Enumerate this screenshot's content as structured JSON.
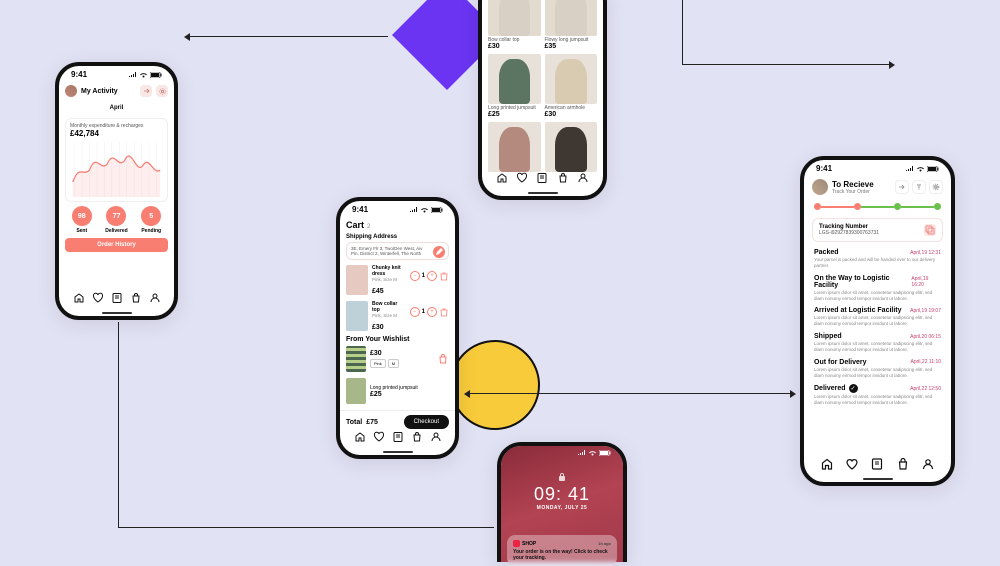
{
  "status": {
    "time": "9:41"
  },
  "activity": {
    "title": "My Activity",
    "month": "April",
    "expend_label": "Monthly expenditure & recharges",
    "expend_value": "£42,784",
    "stats": [
      {
        "value": "98",
        "label": "Sent"
      },
      {
        "value": "77",
        "label": "Delivered"
      },
      {
        "value": "5",
        "label": "Pending"
      }
    ],
    "history_btn": "Order History"
  },
  "chart_data": {
    "type": "line",
    "title": "Monthly expenditure & recharges",
    "xlabel": "",
    "ylabel": "",
    "x": [
      0,
      1,
      2,
      3,
      4,
      5,
      6,
      7,
      8,
      9,
      10,
      11,
      12
    ],
    "values": [
      30,
      55,
      40,
      72,
      48,
      80,
      55,
      85,
      45,
      70,
      38,
      62,
      40
    ]
  },
  "catalog": {
    "products": [
      {
        "name": "Bow collar top",
        "price": "£30",
        "color": "#d9d1c9"
      },
      {
        "name": "Flowy long jumpsuit",
        "price": "£35",
        "color": "#d9d1c9"
      },
      {
        "name": "Long printed jumpsuit",
        "price": "£25",
        "color": "#5b7562"
      },
      {
        "name": "American armhole",
        "price": "£30",
        "color": "#d9cbb2"
      },
      {
        "name": "",
        "price": "",
        "color": "#b58a7e"
      },
      {
        "name": "",
        "price": "",
        "color": "#3f3731"
      }
    ]
  },
  "cart": {
    "title": "Cart",
    "count": "2",
    "address_title": "Shipping Address",
    "address": "3E, Emery Flr 3, Two/Den West, Aiv Pin, District 2, Winterfell, The North",
    "items": [
      {
        "name": "Chunky knit dress",
        "sub": "Pink, Size M",
        "price": "£45",
        "qty": "1"
      },
      {
        "name": "Bow collar top",
        "sub": "Pink, Size M",
        "price": "£30",
        "qty": "1"
      }
    ],
    "wishlist_title": "From Your Wishlist",
    "wishlist": [
      {
        "name": "",
        "price": "£30",
        "chips": [
          "Pink",
          "M"
        ]
      },
      {
        "name": "Long printed jumpsuit",
        "price": "£25",
        "chips": []
      }
    ],
    "total_label": "Total",
    "total": "£75",
    "checkout": "Checkout"
  },
  "lock": {
    "time": "09: 41",
    "date": "MONDAY, JULY 25",
    "app": "SHOP",
    "ago": "1h ago",
    "message": "Your order is on the way! Click to check your tracking."
  },
  "tracking": {
    "title": "To Recieve",
    "subtitle": "Track Your Order",
    "number_label": "Tracking Number",
    "number": "LGS-i92927839300763731",
    "progress_colors": [
      "#f97e72",
      "#f97e72",
      "#6bbf4b",
      "#6bbf4b"
    ],
    "steps": [
      {
        "name": "Packed",
        "ts": "April,19 12:31",
        "desc": "Your parcel is packed and will be handed over to our delivery partner."
      },
      {
        "name": "On the Way to Logistic Facility",
        "ts": "April,19 16:20",
        "desc": "Lorem ipsum dolor sit amet, consetetur sadipscing elitr, sed diam nonumy eirmod tempor invidunt ut labore."
      },
      {
        "name": "Arrived at Logistic Facility",
        "ts": "April,19 19:07",
        "desc": "Lorem ipsum dolor sit amet, consetetur sadipscing elitr, sed diam nonumy eirmod tempor invidunt ut labore."
      },
      {
        "name": "Shipped",
        "ts": "April,20 06:15",
        "desc": "Lorem ipsum dolor sit amet, consetetur sadipscing elitr, sed diam nonumy eirmod tempor invidunt ut labore."
      },
      {
        "name": "Out for Delivery",
        "ts": "April,22 11:10",
        "desc": "Lorem ipsum dolor sit amet, consetetur sadipscing elitr, sed diam nonumy eirmod tempor invidunt ut labore."
      },
      {
        "name": "Delivered",
        "ts": "April,22 12:50",
        "desc": "Lorem ipsum dolor sit amet, consetetur sadipscing elitr, sed diam nonumy eirmod tempor invidunt ut labore.",
        "check": true
      }
    ]
  }
}
